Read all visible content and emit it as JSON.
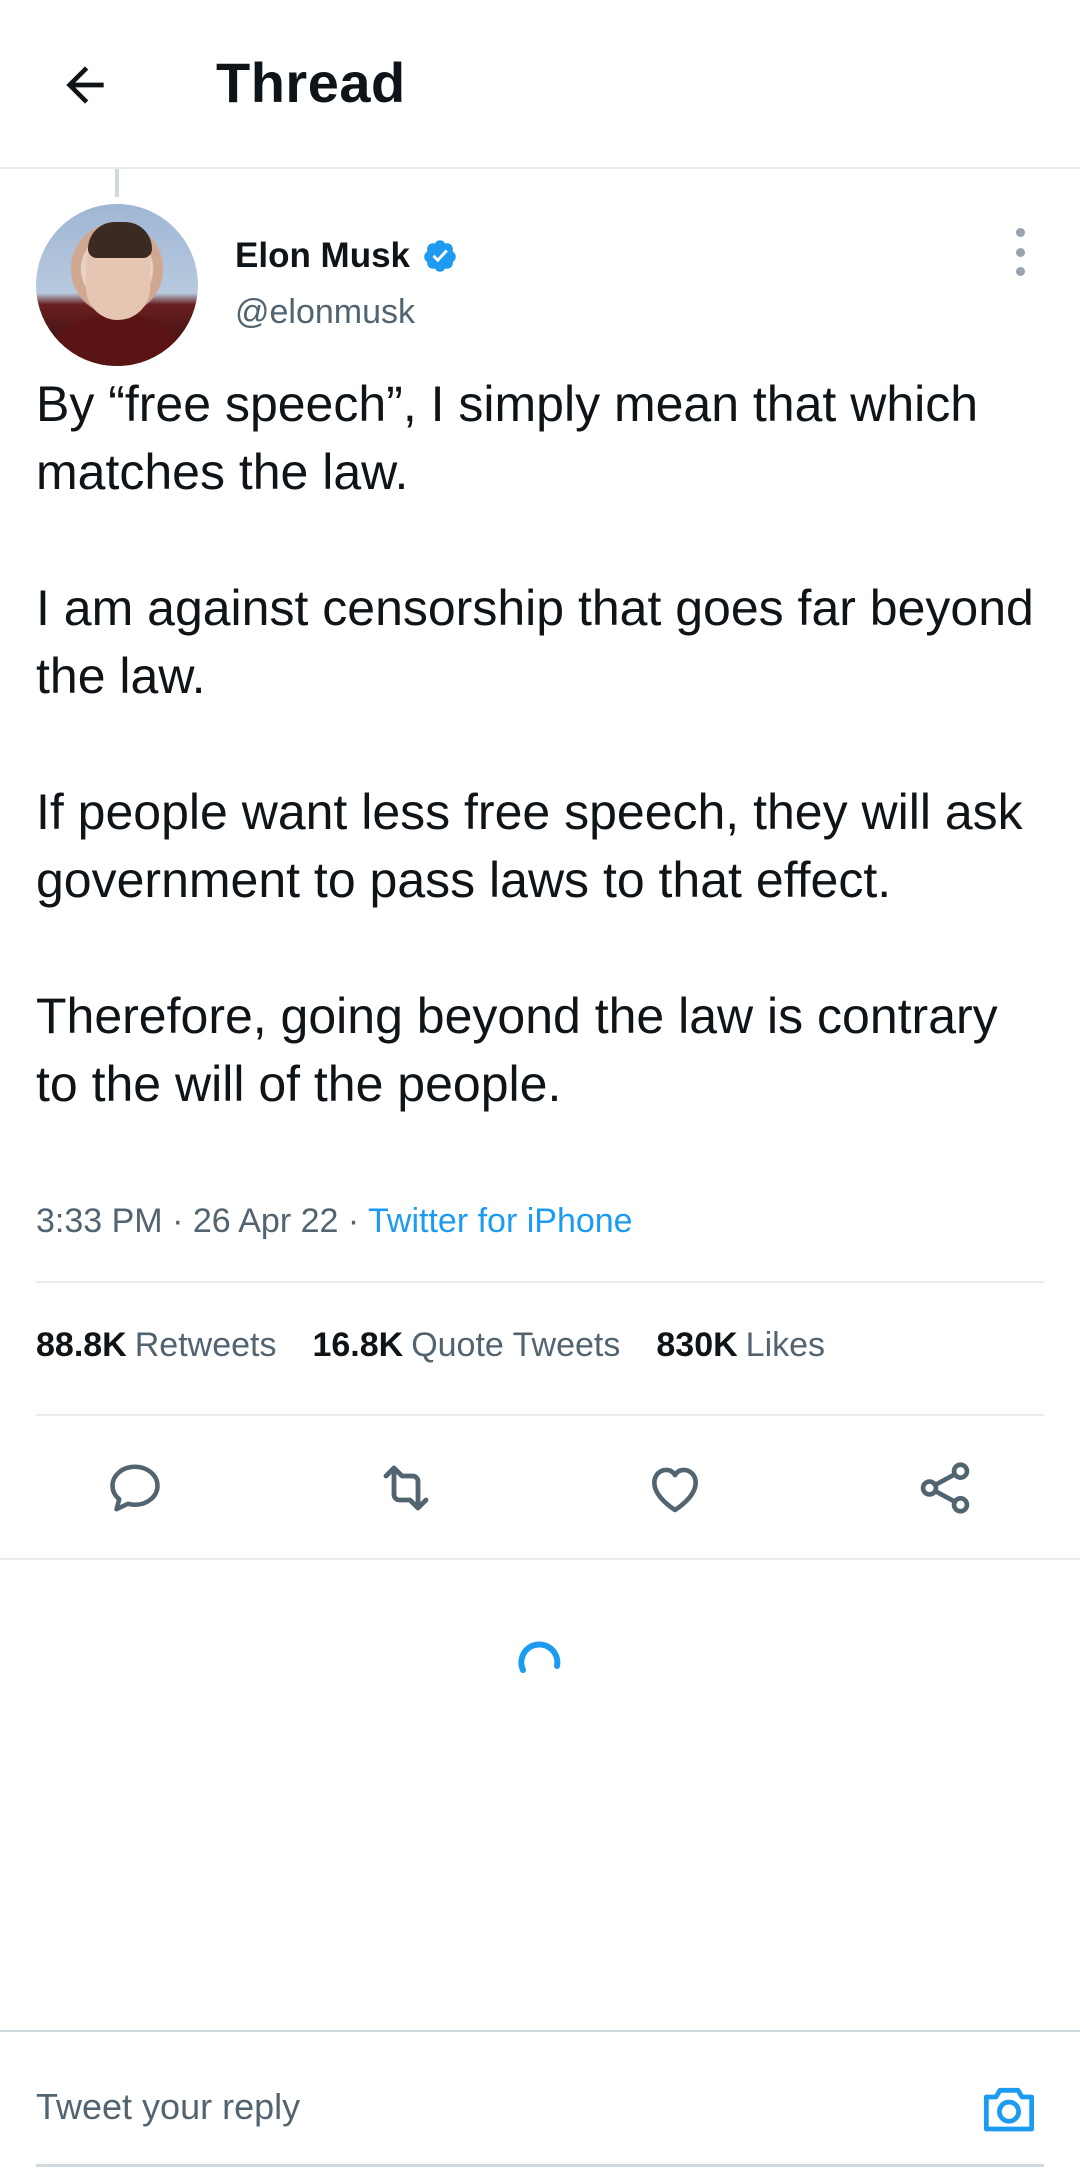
{
  "header": {
    "title": "Thread",
    "back_icon": "arrow-left-icon"
  },
  "tweet": {
    "author": {
      "name": "Elon Musk",
      "handle": "@elonmusk",
      "verified": true
    },
    "text": [
      "By “free speech”, I simply mean that which matches the law.",
      "I am against censorship that goes far beyond the law.",
      "If people want less free speech, they will ask government to pass laws to that effect.",
      "Therefore, going beyond the law is contrary to the will of the people."
    ],
    "time": "3:33 PM",
    "date": "26 Apr 22",
    "separator": " · ",
    "source": "Twitter for iPhone",
    "stats": {
      "retweets_count": "88.8K",
      "retweets_label": "Retweets",
      "quotes_count": "16.8K",
      "quotes_label": "Quote Tweets",
      "likes_count": "830K",
      "likes_label": "Likes"
    }
  },
  "actions": [
    "reply-icon",
    "retweet-icon",
    "like-icon",
    "share-icon"
  ],
  "reply_bar": {
    "placeholder": "Tweet your reply",
    "camera_icon": "camera-icon"
  },
  "colors": {
    "accent": "#1d9bf0",
    "text_primary": "#0f1419",
    "text_secondary": "#536471",
    "divider": "#e8ecee"
  }
}
